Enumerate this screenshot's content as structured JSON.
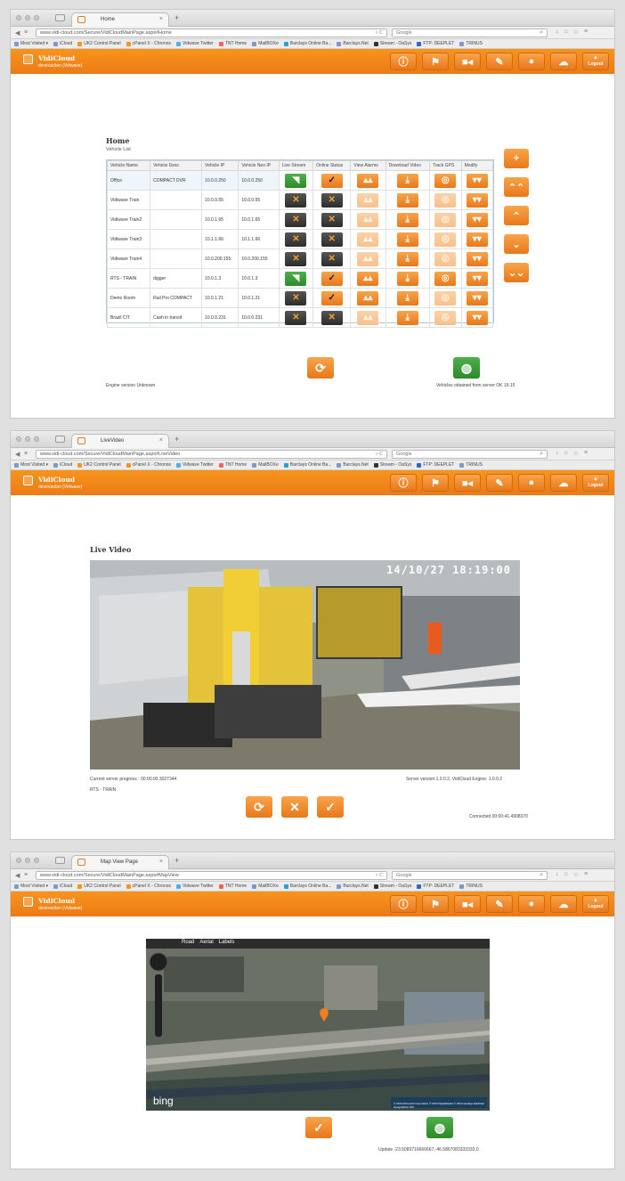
{
  "browser": {
    "bookmarks": [
      "Most Visited ▾",
      "iCloud",
      "UK2 Control Panel",
      "cPanel X - Chronos",
      "Vidwave Twitter",
      "TNT Home",
      "MailBOXe",
      "Barclays Online Ba...",
      "Barclays.Net",
      "Stream - OaSys",
      "FTP: DEEPLET",
      "TRINUS"
    ],
    "search_placeholder": "Google",
    "search_engine_label": "8"
  },
  "app": {
    "brand": "VidiCloud",
    "brand_sub": "devevaritan (Vidwave)",
    "logout": "Logout",
    "header_icons": [
      "info-icon",
      "alarm-flag-icon",
      "video-camera-icon",
      "chat-icon",
      "user-icon",
      "cloud-lock-icon"
    ]
  },
  "screens": [
    {
      "tab_title": "Home",
      "url": "www.vidi-cloud.com/Secure/VidiCloudMainPage.aspx#Home",
      "page_title": "Home",
      "page_subtitle": "Vehicle List",
      "columns": [
        "Vehicle Name",
        "Vehicle Desc",
        "Vehicle IP",
        "Vehicle Neo IP",
        "Live Stream",
        "Online Status",
        "View Alarms",
        "Download Video",
        "Track GPS",
        "Modify"
      ],
      "rows": [
        {
          "name": "Office",
          "desc": "COMPACT DVR",
          "ip": "10.0.0.250",
          "neo": "10.0.0.250",
          "live": "on",
          "online": true,
          "alarms": true,
          "gps": true
        },
        {
          "name": "Vidiwave Train",
          "desc": "",
          "ip": "10.0.0.55",
          "neo": "10.0.0.55",
          "live": "off",
          "online": false,
          "alarms": false,
          "gps": false
        },
        {
          "name": "Vidiwave Train2",
          "desc": "",
          "ip": "10.0.1.65",
          "neo": "10.0.1.65",
          "live": "off",
          "online": false,
          "alarms": false,
          "gps": false
        },
        {
          "name": "Vidiwave Train3",
          "desc": "",
          "ip": "10.1.1.66",
          "neo": "10.1.1.66",
          "live": "off",
          "online": false,
          "alarms": false,
          "gps": false
        },
        {
          "name": "Vidiwave Train4",
          "desc": "",
          "ip": "10.0.200.155",
          "neo": "10.0.200.155",
          "live": "off",
          "online": false,
          "alarms": false,
          "gps": false
        },
        {
          "name": "RTS - TRAIN",
          "desc": "digger",
          "ip": "10.0.1.3",
          "neo": "10.0.1.3",
          "live": "on",
          "online": true,
          "alarms": true,
          "gps": true
        },
        {
          "name": "Demo Room",
          "desc": "Rail Pro COMPACT",
          "ip": "10.0.1.21",
          "neo": "10.0.1.21",
          "live": "off",
          "online": true,
          "alarms": true,
          "gps": false
        },
        {
          "name": "Brazil CIT",
          "desc": "Cash in transit",
          "ip": "10.0.0.231",
          "neo": "10.0.0.231",
          "live": "off",
          "online": false,
          "alarms": false,
          "gps": false
        }
      ],
      "side_buttons": [
        "+",
        "⌃⌃",
        "⌃",
        "⌄",
        "⌄⌄"
      ],
      "footer_left": "Engine version Unknown",
      "footer_right": "Vehicles obtained from server OK 16:15"
    },
    {
      "tab_title": "LiveVideo",
      "url": "www.vidi-cloud.com/Secure/VidiCloudMainPage.aspx#LiveVideo",
      "page_title": "Live Video",
      "video_overlay_time": "14/10/27 18:19:00",
      "progress_text": "Current server progress : 00:00:00.3027344",
      "server_version": "Server version:1.0.0.2, VidiCloud Engine: 1.0.0.2",
      "vehicle_label": "RTS - TRAIN",
      "connected_text": "Connected 00:00:41.4908370"
    },
    {
      "tab_title": "Map View Page",
      "url": "www.vidi-cloud.com/Secure/VidiCloudMainPage.aspx#MapView",
      "map_tabs": [
        "Road",
        "Aerial",
        "Labels"
      ],
      "map_logo": "bing",
      "map_copyright": "© 2014 Microsoft Corporation  © 2013 DigitalGlobe  © 2014 GeoEye  Earthstar Geographics SIO",
      "update_text": "Update -23.5083716666667,-46.5867083333333,0"
    }
  ]
}
